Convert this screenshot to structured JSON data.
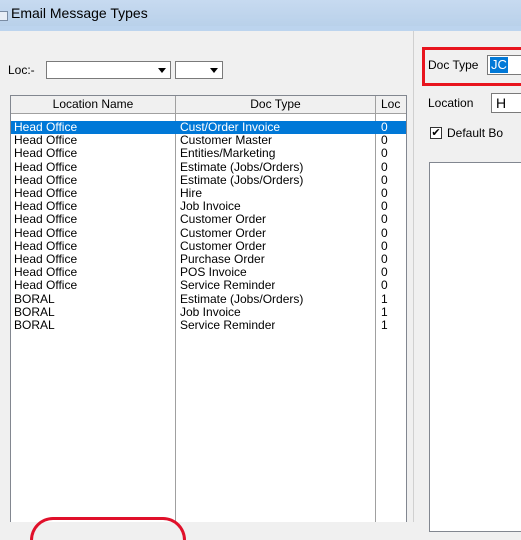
{
  "window": {
    "title": "Email Message Types"
  },
  "filters": {
    "loc_label": "Loc:-",
    "loc_value": "",
    "doc_value": ""
  },
  "grid": {
    "columns": [
      "Location Name",
      "Doc Type",
      "Loc"
    ],
    "rows": [
      [
        "Head Office",
        "Cust/Order Invoice",
        "0"
      ],
      [
        "Head Office",
        "Customer Master",
        "0"
      ],
      [
        "Head Office",
        "Entities/Marketing",
        "0"
      ],
      [
        "Head Office",
        "Estimate (Jobs/Orders)",
        "0"
      ],
      [
        "Head Office",
        "Estimate (Jobs/Orders)",
        "0"
      ],
      [
        "Head Office",
        "Hire",
        "0"
      ],
      [
        "Head Office",
        "Job Invoice",
        "0"
      ],
      [
        "Head Office",
        "Customer Order",
        "0"
      ],
      [
        "Head Office",
        "Customer Order",
        "0"
      ],
      [
        "Head Office",
        "Customer Order",
        "0"
      ],
      [
        "Head Office",
        "Purchase Order",
        "0"
      ],
      [
        "Head Office",
        "POS Invoice",
        "0"
      ],
      [
        "Head Office",
        "Service Reminder",
        "0"
      ],
      [
        "BORAL",
        "Estimate (Jobs/Orders)",
        "1"
      ],
      [
        "BORAL",
        "Job Invoice",
        "1"
      ],
      [
        "BORAL",
        "Service Reminder",
        "1"
      ]
    ],
    "selected_row": 0
  },
  "detail": {
    "doc_type_label": "Doc Type",
    "doc_type_value": "JC",
    "location_label": "Location",
    "location_value": "H",
    "default_checkbox_label": "Default Bo",
    "default_checked": true,
    "check_mark": "✔"
  },
  "colors": {
    "selection": "#0078d7",
    "highlight_border": "#e8141e"
  }
}
